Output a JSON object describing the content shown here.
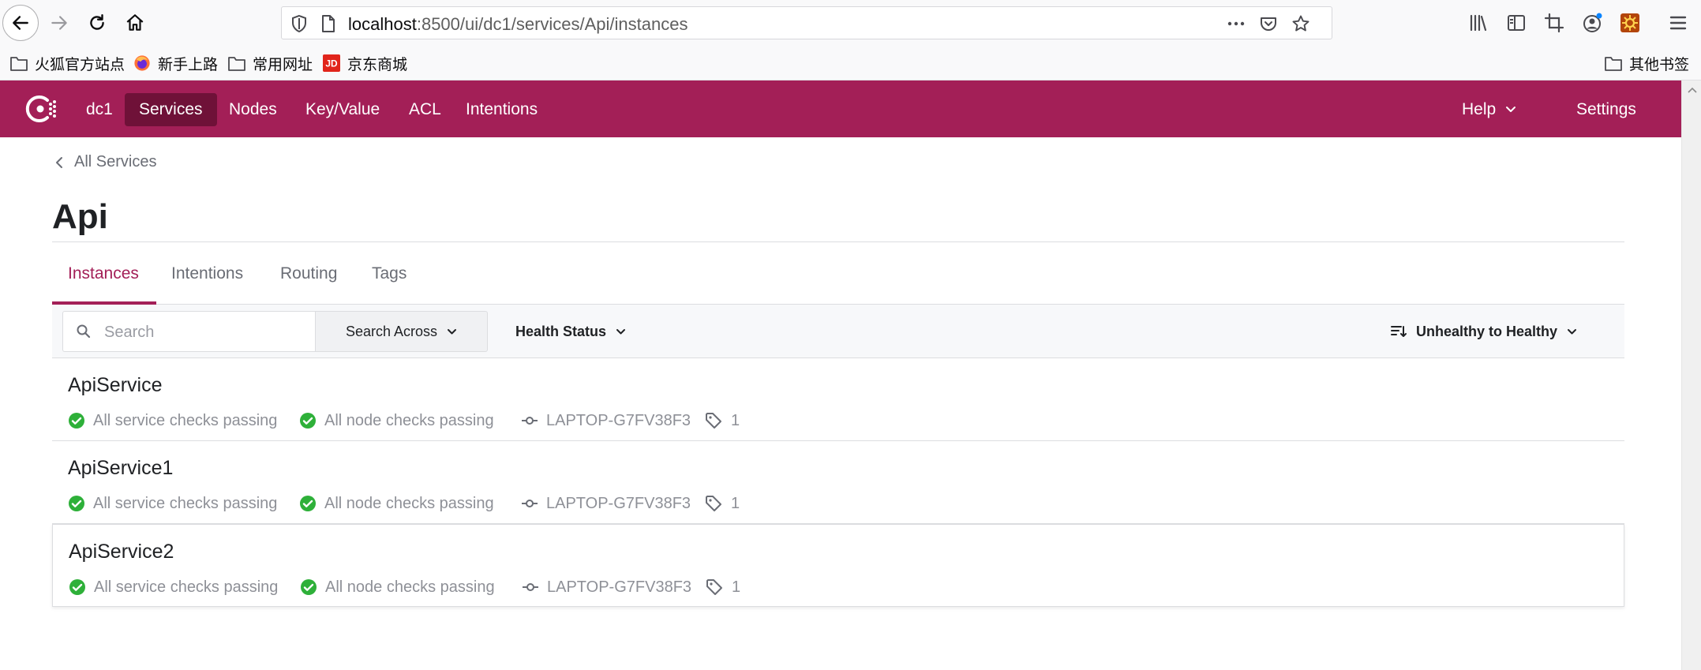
{
  "browser": {
    "url_host": "localhost",
    "url_path": ":8500/ui/dc1/services/Api/instances",
    "bookmarks": [
      {
        "label": "火狐官方站点",
        "icon": "folder-icon"
      },
      {
        "label": "新手上路",
        "icon": "firefox-icon"
      },
      {
        "label": "常用网址",
        "icon": "folder-icon"
      },
      {
        "label": "京东商城",
        "icon": "jd-icon",
        "icon_text": "JD",
        "icon_color": "#e1251b"
      }
    ],
    "other_bookmarks": "其他书签"
  },
  "nav": {
    "datacenter": "dc1",
    "items": [
      "Services",
      "Nodes",
      "Key/Value",
      "ACL",
      "Intentions"
    ],
    "active": "Services",
    "help": "Help",
    "settings": "Settings",
    "brand_color": "#a31f57",
    "active_color": "#6f1138"
  },
  "breadcrumb": "All Services",
  "page_title": "Api",
  "tabs": [
    "Instances",
    "Intentions",
    "Routing",
    "Tags"
  ],
  "active_tab": "Instances",
  "filters": {
    "search_placeholder": "Search",
    "search_across": "Search Across",
    "health_status": "Health Status",
    "sort": "Unhealthy to Healthy"
  },
  "instances": [
    {
      "name": "ApiService",
      "service_checks": "All service checks passing",
      "node_checks": "All node checks passing",
      "node": "LAPTOP-G7FV38F3",
      "tags": "1"
    },
    {
      "name": "ApiService1",
      "service_checks": "All service checks passing",
      "node_checks": "All node checks passing",
      "node": "LAPTOP-G7FV38F3",
      "tags": "1"
    },
    {
      "name": "ApiService2",
      "service_checks": "All service checks passing",
      "node_checks": "All node checks passing",
      "node": "LAPTOP-G7FV38F3",
      "tags": "1"
    }
  ],
  "colors": {
    "passing": "#2eb039",
    "meta_text": "#8e9097"
  }
}
